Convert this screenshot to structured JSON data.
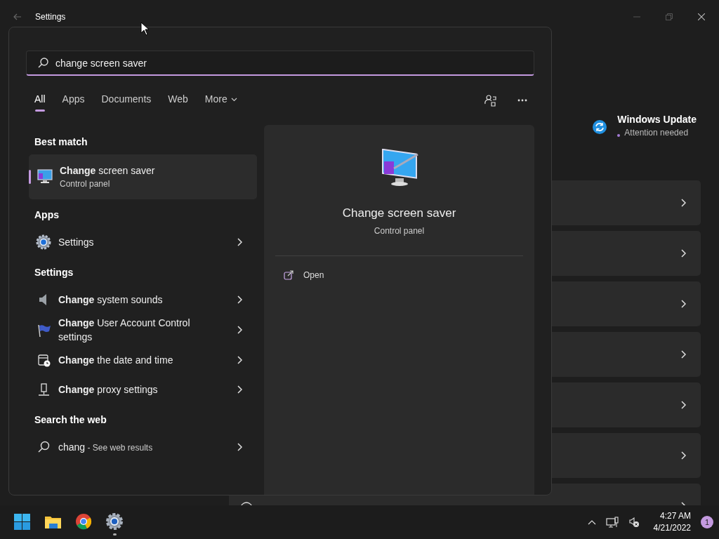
{
  "window": {
    "title": "Settings"
  },
  "update": {
    "title": "Windows Update",
    "status": "Attention needed"
  },
  "cards": [
    {
      "kind": "link"
    },
    {
      "kind": "link"
    },
    {
      "kind": "link"
    },
    {
      "kind": "link"
    },
    {
      "kind": "link"
    },
    {
      "kind": "link"
    },
    {
      "kind": "check"
    }
  ],
  "search": {
    "value": "change screen saver"
  },
  "filters": [
    {
      "label": "All",
      "selected": true,
      "kind": "tab"
    },
    {
      "label": "Apps",
      "selected": false,
      "kind": "tab"
    },
    {
      "label": "Documents",
      "selected": false,
      "kind": "tab"
    },
    {
      "label": "Web",
      "selected": false,
      "kind": "tab"
    },
    {
      "label": "More",
      "selected": false,
      "kind": "dropdown"
    }
  ],
  "best_match": {
    "heading": "Best match",
    "title": "**Change** screen saver",
    "subtitle": "Control panel",
    "selected": true
  },
  "sections": [
    {
      "heading": "Apps",
      "items": [
        {
          "title": "Settings",
          "kind": "gear"
        }
      ]
    },
    {
      "heading": "Settings",
      "items": [
        {
          "title": "**Change** system sounds",
          "kind": "speaker"
        },
        {
          "title": "**Change** User Account Control settings",
          "kind": "flag"
        },
        {
          "title": "**Change** the date and time",
          "kind": "calendar"
        },
        {
          "title": "**Change** proxy settings",
          "kind": "proxy"
        }
      ]
    },
    {
      "heading": "Search the web",
      "items": [
        {
          "title": "chang",
          "suffix": "- See web results",
          "kind": "search"
        }
      ]
    }
  ],
  "preview": {
    "title": "Change screen saver",
    "subtitle": "Control panel",
    "actions": [
      {
        "label": "Open"
      }
    ]
  },
  "taskbar": {
    "apps": [
      {
        "kind": "start",
        "running": false
      },
      {
        "kind": "files",
        "running": false
      },
      {
        "kind": "browser",
        "running": false
      },
      {
        "kind": "settings",
        "running": true
      }
    ],
    "time": "4:27 AM",
    "date": "4/21/2022",
    "notifications": "1"
  }
}
